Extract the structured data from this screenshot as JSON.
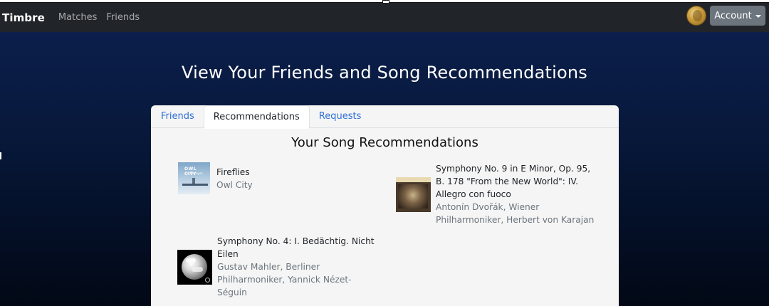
{
  "navbar": {
    "brand": "Timbre",
    "links": [
      "Matches",
      "Friends"
    ],
    "account_label": "Account"
  },
  "hero": {
    "title": "View Your Friends and Song Recommendations"
  },
  "tabs": [
    "Friends",
    "Recommendations",
    "Requests"
  ],
  "active_tab": "Recommendations",
  "section_title": "Your Song Recommendations",
  "songs": [
    {
      "title": "Fireflies",
      "artist": "Owl City",
      "art_icon": "owl-city-album-art"
    },
    {
      "title": "Symphony No. 9 in E Minor, Op. 95, B. 178 \"From the New World\": IV. Allegro con fuoco",
      "artist": "Antonín Dvořák, Wiener Philharmoniker, Herbert von Karajan",
      "art_icon": "deutsche-grammophon-album-art"
    },
    {
      "title": "Symphony No. 4: I. Bedächtig. Nicht Eilen",
      "artist": "Gustav Mahler, Berliner Philharmoniker, Yannick Nézet-Séguin",
      "art_icon": "earth-album-art"
    }
  ],
  "colors": {
    "navbar_bg": "#212529",
    "link": "#2f6fd6",
    "account_button": "#6c757d"
  }
}
